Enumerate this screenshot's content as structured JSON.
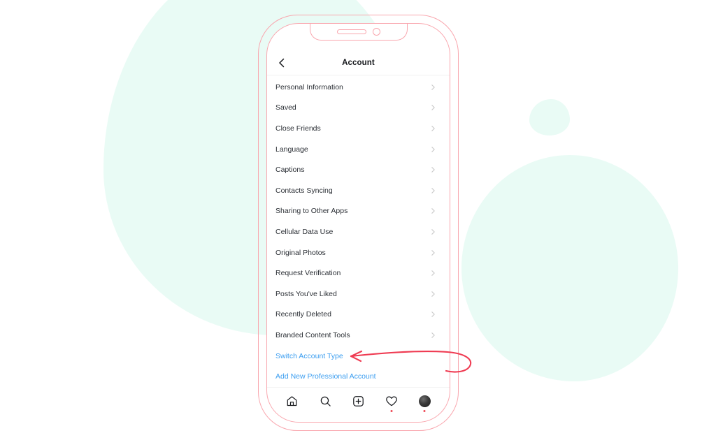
{
  "background": {
    "page_color": "#ffffff",
    "blob_color": "#e9fbf5"
  },
  "phone": {
    "frame_color": "#f9a6ae",
    "notch": {
      "speaker_label": "speaker-slot",
      "camera_label": "front-camera"
    }
  },
  "app": {
    "header": {
      "back_icon": "chevron-left-icon",
      "title": "Account"
    },
    "menu_items": [
      {
        "label": "Personal Information",
        "type": "nav",
        "chevron": "chevron-right-icon"
      },
      {
        "label": "Saved",
        "type": "nav",
        "chevron": "chevron-right-icon"
      },
      {
        "label": "Close Friends",
        "type": "nav",
        "chevron": "chevron-right-icon"
      },
      {
        "label": "Language",
        "type": "nav",
        "chevron": "chevron-right-icon"
      },
      {
        "label": "Captions",
        "type": "nav",
        "chevron": "chevron-right-icon"
      },
      {
        "label": "Contacts Syncing",
        "type": "nav",
        "chevron": "chevron-right-icon"
      },
      {
        "label": "Sharing to Other Apps",
        "type": "nav",
        "chevron": "chevron-right-icon"
      },
      {
        "label": "Cellular Data Use",
        "type": "nav",
        "chevron": "chevron-right-icon"
      },
      {
        "label": "Original Photos",
        "type": "nav",
        "chevron": "chevron-right-icon"
      },
      {
        "label": "Request Verification",
        "type": "nav",
        "chevron": "chevron-right-icon"
      },
      {
        "label": "Posts You've Liked",
        "type": "nav",
        "chevron": "chevron-right-icon"
      },
      {
        "label": "Recently Deleted",
        "type": "nav",
        "chevron": "chevron-right-icon"
      },
      {
        "label": "Branded Content Tools",
        "type": "nav",
        "chevron": "chevron-right-icon"
      },
      {
        "label": "Switch Account Type",
        "type": "link"
      },
      {
        "label": "Add New Professional Account",
        "type": "link"
      }
    ],
    "link_color": "#3c9ef0",
    "text_color": "#2b2f35",
    "bottom_nav": [
      {
        "icon": "home-icon",
        "badge": false
      },
      {
        "icon": "search-icon",
        "badge": false
      },
      {
        "icon": "add-post-icon",
        "badge": false
      },
      {
        "icon": "heart-icon",
        "badge": true
      },
      {
        "icon": "profile-avatar-icon",
        "badge": true
      }
    ],
    "badge_color": "#ed4956"
  },
  "annotation": {
    "arrow_icon": "curved-arrow-annotation",
    "arrow_color": "#ef3b52",
    "points_to": "Switch Account Type"
  }
}
